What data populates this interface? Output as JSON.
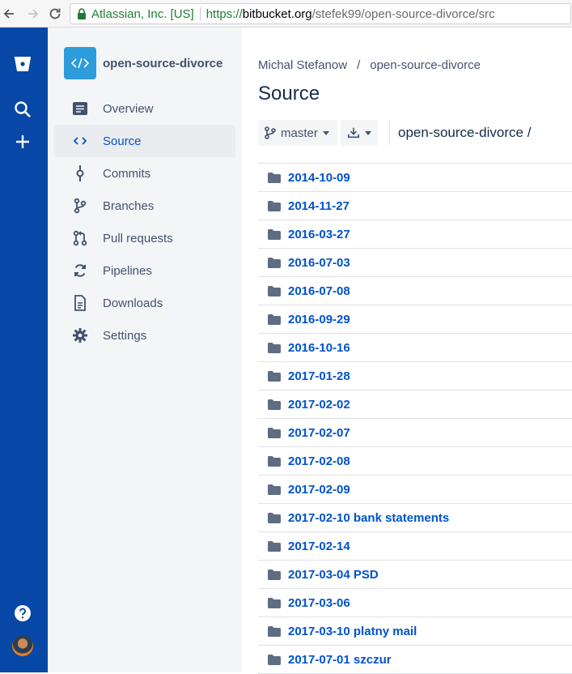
{
  "browser": {
    "cert_name": "Atlassian, Inc. [US]",
    "url_scheme": "https://",
    "url_host": "bitbucket.org",
    "url_path": "/stefek99/open-source-divorce/src"
  },
  "global_nav": {
    "logo_icon": "bitbucket-logo-icon",
    "search_icon": "search-icon",
    "create_icon": "plus-icon",
    "help_icon": "help-icon",
    "avatar": "user-avatar"
  },
  "repo": {
    "name": "open-source-divorce",
    "avatar_icon": "code-icon"
  },
  "sidebar": {
    "items": [
      {
        "label": "Overview",
        "icon": "overview-icon",
        "active": false
      },
      {
        "label": "Source",
        "icon": "code-icon",
        "active": true
      },
      {
        "label": "Commits",
        "icon": "commit-icon",
        "active": false
      },
      {
        "label": "Branches",
        "icon": "branch-icon",
        "active": false
      },
      {
        "label": "Pull requests",
        "icon": "pull-request-icon",
        "active": false
      },
      {
        "label": "Pipelines",
        "icon": "pipelines-icon",
        "active": false
      },
      {
        "label": "Downloads",
        "icon": "document-icon",
        "active": false
      },
      {
        "label": "Settings",
        "icon": "gear-icon",
        "active": false
      }
    ]
  },
  "main": {
    "breadcrumb": {
      "owner": "Michal Stefanow",
      "separator": "/",
      "repo": "open-source-divorce"
    },
    "title": "Source",
    "branch_label": "master",
    "path": "open-source-divorce /",
    "files": [
      "2014-10-09",
      "2014-11-27",
      "2016-03-27",
      "2016-07-03",
      "2016-07-08",
      "2016-09-29",
      "2016-10-16",
      "2017-01-28",
      "2017-02-02",
      "2017-02-07",
      "2017-02-08",
      "2017-02-09",
      "2017-02-10 bank statements",
      "2017-02-14",
      "2017-03-04 PSD",
      "2017-03-06",
      "2017-03-10 platny mail",
      "2017-07-01 szczur"
    ]
  },
  "colors": {
    "global_nav_bg": "#0747a6",
    "link": "#0052cc",
    "secure": "#1e7d32"
  }
}
